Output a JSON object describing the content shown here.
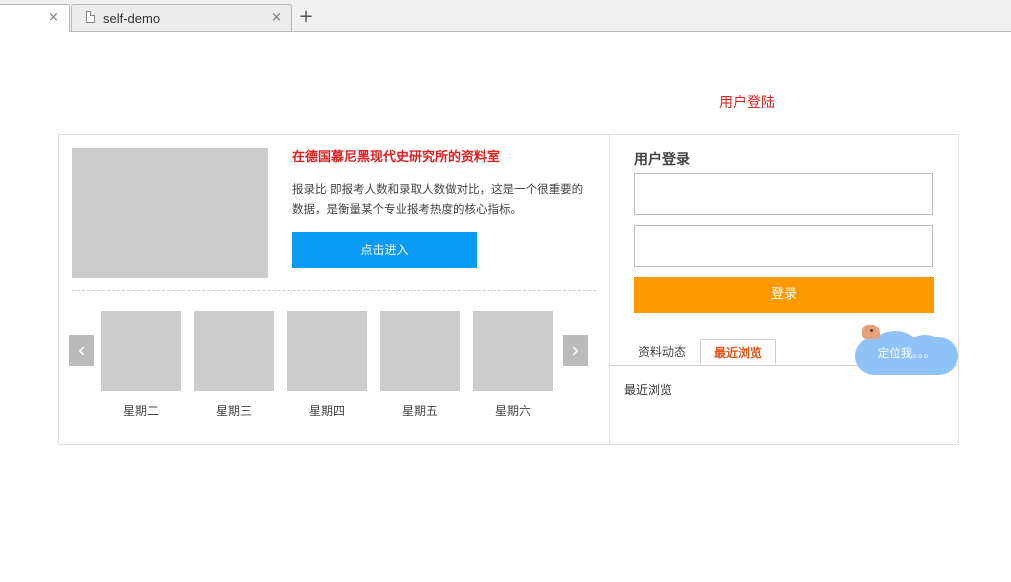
{
  "browser": {
    "active_tab_close": "×",
    "tab_title": "self-demo",
    "tab_close": "×",
    "new_tab": "+"
  },
  "header": {
    "login_link": "用户登陆"
  },
  "feature": {
    "title": "在德国慕尼黑现代史研究所的资料室",
    "description": "报录比 即报考人数和录取人数做对比，这是一个很重要的数据，是衡量某个专业报考热度的核心指标。",
    "enter_button": "点击进入"
  },
  "carousel": {
    "prev": "‹",
    "next": "›",
    "items": [
      {
        "label": "星期二"
      },
      {
        "label": "星期三"
      },
      {
        "label": "星期四"
      },
      {
        "label": "星期五"
      },
      {
        "label": "星期六"
      }
    ]
  },
  "login": {
    "heading": "用户登录",
    "username_value": "",
    "password_value": "",
    "submit": "登录"
  },
  "info_tabs": {
    "tabs": [
      {
        "label": "资料动态"
      },
      {
        "label": "最近浏览"
      }
    ],
    "content": "最近浏览"
  },
  "widget": {
    "text": "定位我。。。"
  },
  "colors": {
    "accent_red": "#e21e1e",
    "primary_blue": "#0b9af5",
    "login_orange": "#ff9900",
    "active_tab_orange": "#e2551c",
    "placeholder_gray": "#cccccc",
    "cloud_blue": "#8fc3f8"
  },
  "icons": {
    "tab_page": "page-icon",
    "close": "close-icon",
    "add": "plus-icon",
    "prev": "chevron-left-icon",
    "next": "chevron-right-icon"
  }
}
